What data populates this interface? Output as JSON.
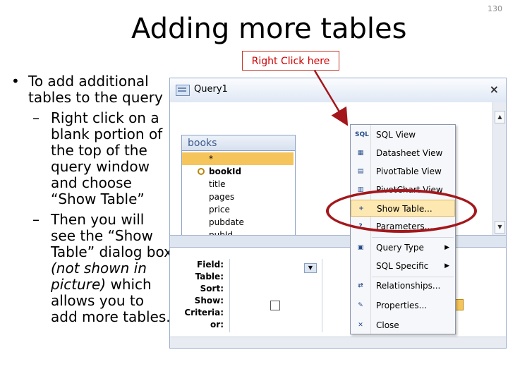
{
  "slide": {
    "title": "Adding more tables",
    "page_number": "130",
    "callout": "Right Click here"
  },
  "bullets": {
    "main": "To add additional tables to the query",
    "sub1": "Right click on a blank portion of the top of the query window and choose “Show Table”",
    "sub2_a": "Then you will see the “Show Table” dialog box ",
    "sub2_italic": "(not shown in picture)",
    "sub2_b": " which allows you to add more tables."
  },
  "window": {
    "tab_title": "Query1",
    "close_glyph": "×"
  },
  "table_box": {
    "name": "books",
    "fields": [
      "*",
      "bookId",
      "title",
      "pages",
      "price",
      "pubdate",
      "pubId"
    ]
  },
  "grid": {
    "row_labels": [
      "Field:",
      "Table:",
      "Sort:",
      "Show:",
      "Criteria:",
      "or:"
    ]
  },
  "context_menu": {
    "items": [
      {
        "icon": "SQL",
        "label": "SQL View"
      },
      {
        "icon": "▦",
        "label": "Datasheet View"
      },
      {
        "icon": "▤",
        "label": "PivotTable View"
      },
      {
        "icon": "▥",
        "label": "PivotChart View"
      },
      {
        "icon": "+",
        "label": "Show Table..."
      },
      {
        "icon": "?",
        "label": "Parameters..."
      },
      {
        "icon": "▣",
        "label": "Query Type"
      },
      {
        "icon": "",
        "label": "SQL Specific"
      },
      {
        "icon": "⇄",
        "label": "Relationships..."
      },
      {
        "icon": "✎",
        "label": "Properties..."
      },
      {
        "icon": "✕",
        "label": "Close"
      }
    ],
    "highlighted": "Show Table...",
    "arrow_glyph": "▶"
  },
  "colors": {
    "callout_border": "#c0392b",
    "ellipse": "#a3171c",
    "selected_row": "#f5c55c",
    "menu_highlight": "#fde8b2"
  }
}
